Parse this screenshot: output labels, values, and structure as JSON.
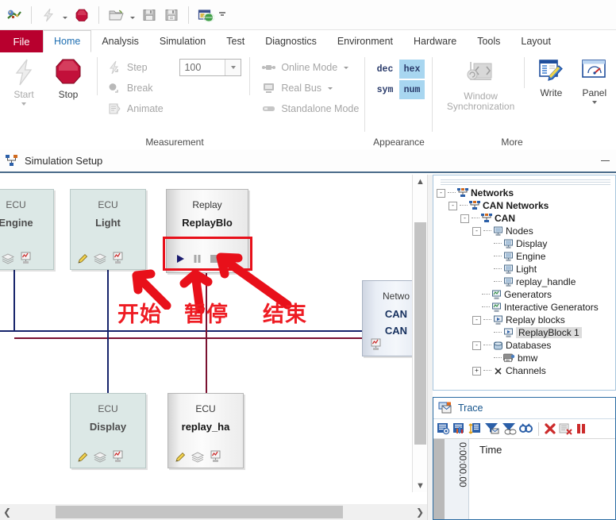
{
  "quick_access": {
    "items": [
      {
        "name": "app-logo-icon",
        "icon": "canoe-logo"
      },
      {
        "name": "start-measurement-icon",
        "icon": "lightning"
      },
      {
        "name": "stop-measurement-icon",
        "icon": "red-octagon"
      },
      {
        "name": "open-configuration-icon",
        "icon": "folder-open"
      },
      {
        "name": "save-configuration-icon",
        "icon": "floppy-disk"
      },
      {
        "name": "save-as-icon",
        "icon": "floppy-disk-alt"
      },
      {
        "name": "open-folder-globe-icon",
        "icon": "window-globe"
      },
      {
        "name": "customize-toolbar-icon",
        "icon": "overflow-chevron"
      }
    ]
  },
  "ribbon": {
    "file_tab": "File",
    "tabs": [
      "Home",
      "Analysis",
      "Simulation",
      "Test",
      "Diagnostics",
      "Environment",
      "Hardware",
      "Tools",
      "Layout"
    ],
    "active_tab": "Home",
    "groups": [
      {
        "title": "Measurement",
        "big_buttons": [
          {
            "label": "Start",
            "enabled": false,
            "has_caret": true
          },
          {
            "label": "Stop",
            "enabled": true,
            "has_caret": false
          }
        ],
        "small_buttons": [
          {
            "label": "Step",
            "enabled": false
          },
          {
            "label": "Break",
            "enabled": false
          },
          {
            "label": "Animate",
            "enabled": false
          }
        ],
        "spinner_value": "100",
        "mode_buttons": [
          {
            "label": "Online Mode",
            "enabled": false,
            "has_caret": true
          },
          {
            "label": "Real Bus",
            "enabled": false,
            "has_caret": true
          },
          {
            "label": "Standalone Mode",
            "enabled": false,
            "has_caret": false
          }
        ]
      },
      {
        "title": "Appearance",
        "toggles": [
          {
            "label": "dec",
            "selected": false
          },
          {
            "label": "hex",
            "selected": true
          },
          {
            "label": "sym",
            "selected": false
          },
          {
            "label": "num",
            "selected": true
          }
        ]
      },
      {
        "title": "More",
        "big_buttons": [
          {
            "label": "Window Synchronization",
            "enabled": false,
            "has_caret": false
          },
          {
            "label": "Write",
            "enabled": true,
            "has_caret": false
          },
          {
            "label": "Panel",
            "enabled": true,
            "has_caret": true
          }
        ]
      }
    ]
  },
  "document": {
    "title": "Simulation Setup"
  },
  "canvas": {
    "nodes": [
      {
        "kind": "ECU",
        "name": "Engine",
        "icons": [
          "pencil-disabled",
          "layers-icon",
          "graph-icon"
        ],
        "style": "plain"
      },
      {
        "kind": "ECU",
        "name": "Light",
        "icons": [
          "pencil-icon",
          "layers-icon",
          "graph-icon"
        ],
        "style": "plain"
      },
      {
        "kind": "ECU",
        "name": "Display",
        "icons": [
          "pencil-icon",
          "layers-icon",
          "graph-icon"
        ],
        "style": "plain"
      },
      {
        "kind": "ECU",
        "name": "replay_ha",
        "icons": [
          "pencil-icon",
          "layers-icon",
          "graph-icon"
        ],
        "style": "gradient"
      },
      {
        "kind": "Replay",
        "name": "ReplayBlo",
        "icons": [
          "play-icon",
          "pause-icon",
          "stop-icon"
        ],
        "style": "gradient"
      },
      {
        "kind": "Netwo",
        "name": "CAN",
        "name2": "CAN",
        "icons": [
          "graph-icon"
        ],
        "style": "network"
      }
    ],
    "replay_controls": [
      {
        "name": "play-button",
        "glyph": "play"
      },
      {
        "name": "pause-button",
        "glyph": "pause"
      },
      {
        "name": "stop-button",
        "glyph": "stop"
      }
    ],
    "annotations": [
      {
        "text": "开始",
        "meaning": "start"
      },
      {
        "text": "暂停",
        "meaning": "pause"
      },
      {
        "text": "结束",
        "meaning": "stop"
      }
    ],
    "bus_colors": {
      "upper": "#16236b",
      "lower": "#7a1130"
    },
    "highlight_color": "#e8101a"
  },
  "tree": {
    "nodes": [
      {
        "label": "Networks",
        "indent": 0,
        "expander": "-",
        "icon": "network-icon",
        "bold": true,
        "selected": false
      },
      {
        "label": "CAN Networks",
        "indent": 1,
        "expander": "-",
        "icon": "network-icon",
        "bold": true,
        "selected": false
      },
      {
        "label": "CAN",
        "indent": 2,
        "expander": "-",
        "icon": "network-icon",
        "bold": true,
        "selected": false
      },
      {
        "label": "Nodes",
        "indent": 3,
        "expander": "-",
        "icon": "node-icon",
        "bold": false,
        "selected": false
      },
      {
        "label": "Display",
        "indent": 4,
        "expander": "",
        "icon": "node-icon",
        "bold": false,
        "selected": false
      },
      {
        "label": "Engine",
        "indent": 4,
        "expander": "",
        "icon": "node-icon",
        "bold": false,
        "selected": false
      },
      {
        "label": "Light",
        "indent": 4,
        "expander": "",
        "icon": "node-icon",
        "bold": false,
        "selected": false
      },
      {
        "label": "replay_handle",
        "indent": 4,
        "expander": "",
        "icon": "node-icon",
        "bold": false,
        "selected": false
      },
      {
        "label": "Generators",
        "indent": 3,
        "expander": "",
        "icon": "generator-icon",
        "bold": false,
        "selected": false
      },
      {
        "label": "Interactive Generators",
        "indent": 3,
        "expander": "",
        "icon": "generator-icon",
        "bold": false,
        "selected": false
      },
      {
        "label": "Replay blocks",
        "indent": 3,
        "expander": "-",
        "icon": "replay-icon",
        "bold": false,
        "selected": false
      },
      {
        "label": "ReplayBlock 1",
        "indent": 4,
        "expander": "",
        "icon": "replay-icon",
        "bold": false,
        "selected": true
      },
      {
        "label": "Databases",
        "indent": 3,
        "expander": "-",
        "icon": "database-icon",
        "bold": false,
        "selected": false
      },
      {
        "label": "bmw",
        "indent": 4,
        "expander": "",
        "icon": "dbc-icon",
        "bold": false,
        "selected": false
      },
      {
        "label": "Channels",
        "indent": 3,
        "expander": "+",
        "icon": "channel-icon",
        "bold": false,
        "selected": false
      }
    ]
  },
  "trace": {
    "title": "Trace",
    "toolbar_icons": [
      "trace-config-icon",
      "statistics-icon",
      "expand-rows-icon",
      "filter-icon",
      "stop-filter-icon",
      "find-icon",
      "clear-icon",
      "clear-filtered-icon",
      "pause-trace-icon"
    ],
    "time_column_label": "Time",
    "time_value": "0:00:00.00"
  }
}
